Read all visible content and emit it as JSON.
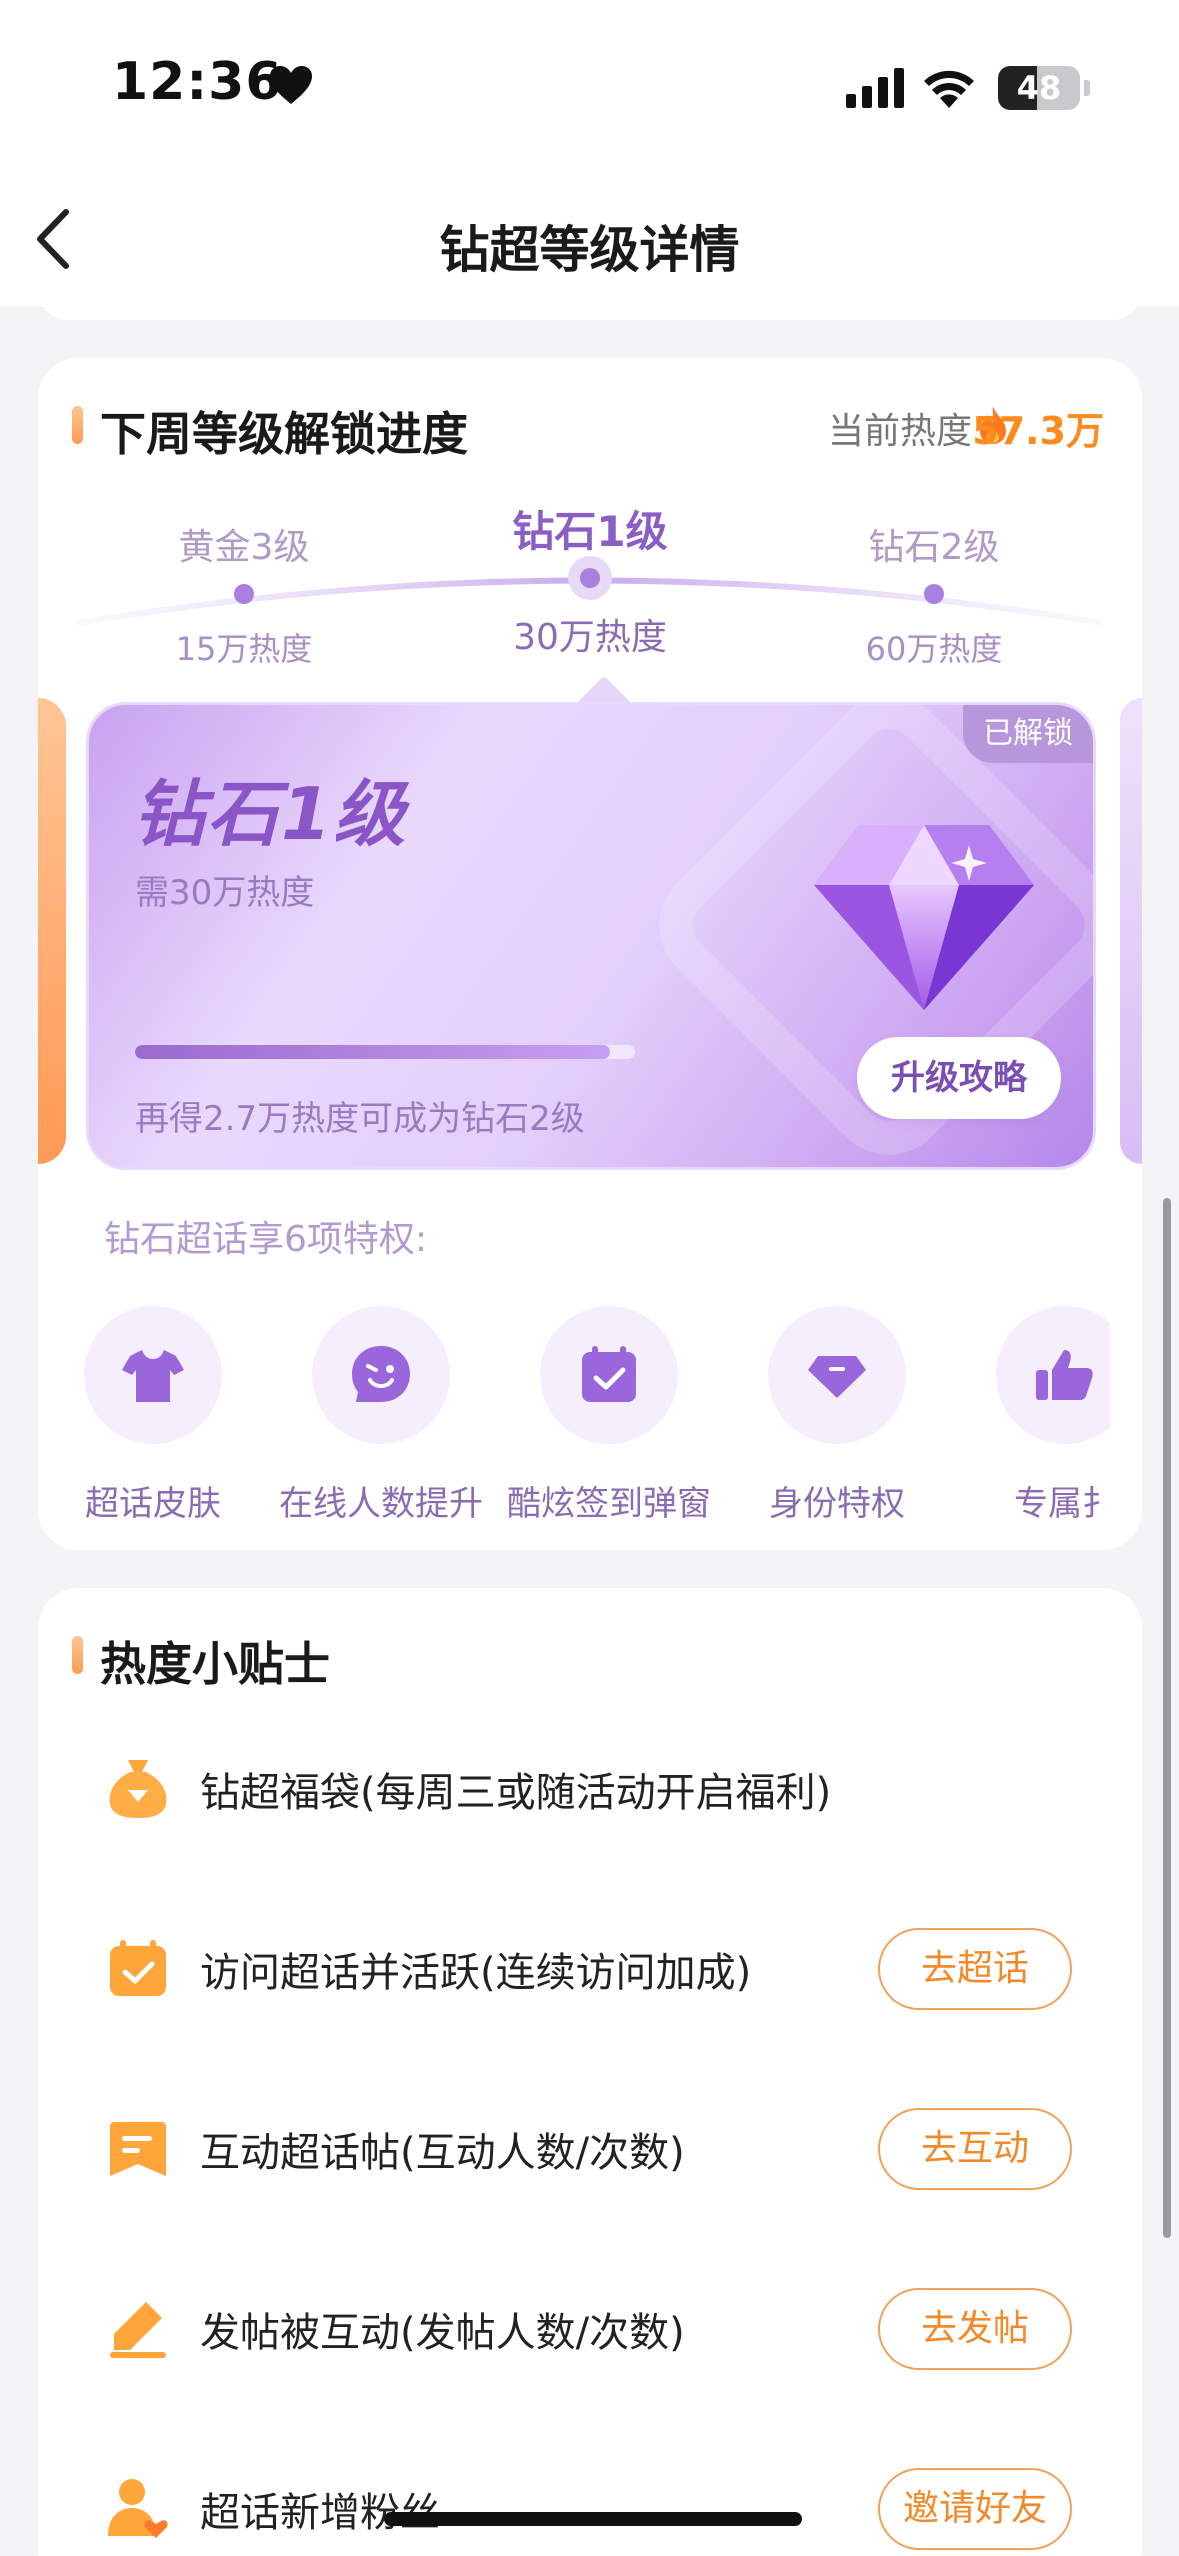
{
  "status_bar": {
    "time": "12:36",
    "battery": "48",
    "battery_level": 0.48
  },
  "nav": {
    "title": "钻超等级详情"
  },
  "progress_section": {
    "title": "下周等级解锁进度",
    "current_heat_label": "当前热度",
    "current_heat_value": "57.3万",
    "levels": [
      {
        "name": "黄金3级",
        "heat": "15万热度"
      },
      {
        "name": "钻石1级",
        "heat": "30万热度"
      },
      {
        "name": "钻石2级",
        "heat": "60万热度"
      }
    ],
    "level_card": {
      "badge": "已解锁",
      "title": "钻石1级",
      "requirement": "需30万热度",
      "progress": 0.95,
      "hint": "再得2.7万热度可成为钻石2级",
      "upgrade_button": "升级攻略"
    },
    "perks_title": "钻石超话享6项特权:",
    "perks": [
      {
        "label": "超话皮肤",
        "icon": "tshirt-icon"
      },
      {
        "label": "在线人数提升",
        "icon": "wink-face-icon"
      },
      {
        "label": "酷炫签到弹窗",
        "icon": "calendar-check-icon"
      },
      {
        "label": "身份特权",
        "icon": "diamond-badge-icon"
      },
      {
        "label": "专属扌",
        "icon": "thumbs-up-icon"
      }
    ]
  },
  "tips_section": {
    "title": "热度小贴士",
    "items": [
      {
        "text": "钻超福袋(每周三或随活动开启福利)",
        "button": "",
        "icon": "lucky-bag-icon"
      },
      {
        "text": "访问超话并活跃(连续访问加成)",
        "button": "去超话",
        "icon": "calendar-check-icon"
      },
      {
        "text": "互动超话帖(互动人数/次数)",
        "button": "去互动",
        "icon": "bookmark-icon"
      },
      {
        "text": "发帖被互动(发帖人数/次数)",
        "button": "去发帖",
        "icon": "pencil-icon"
      },
      {
        "text": "超话新增粉丝",
        "button": "邀请好友",
        "icon": "user-heart-icon"
      }
    ]
  },
  "colors": {
    "accent_orange": "#ff8a1f",
    "accent_purple": "#8a5fc4"
  }
}
